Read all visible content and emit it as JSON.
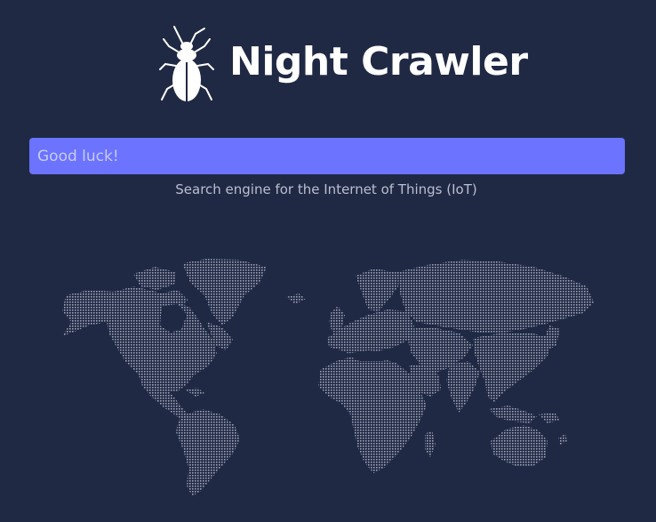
{
  "brand": {
    "name": "Night Crawler",
    "logo_icon": "beetle-icon"
  },
  "search": {
    "placeholder": "Good luck!",
    "value": ""
  },
  "tagline": "Search engine for the Internet of Things (IoT)",
  "map": {
    "icon": "dotted-world-map",
    "dot_color": "#9ca3b6"
  },
  "colors": {
    "background": "#202944",
    "search_bg": "#6b73ff",
    "text_muted": "#b9bfcf"
  }
}
